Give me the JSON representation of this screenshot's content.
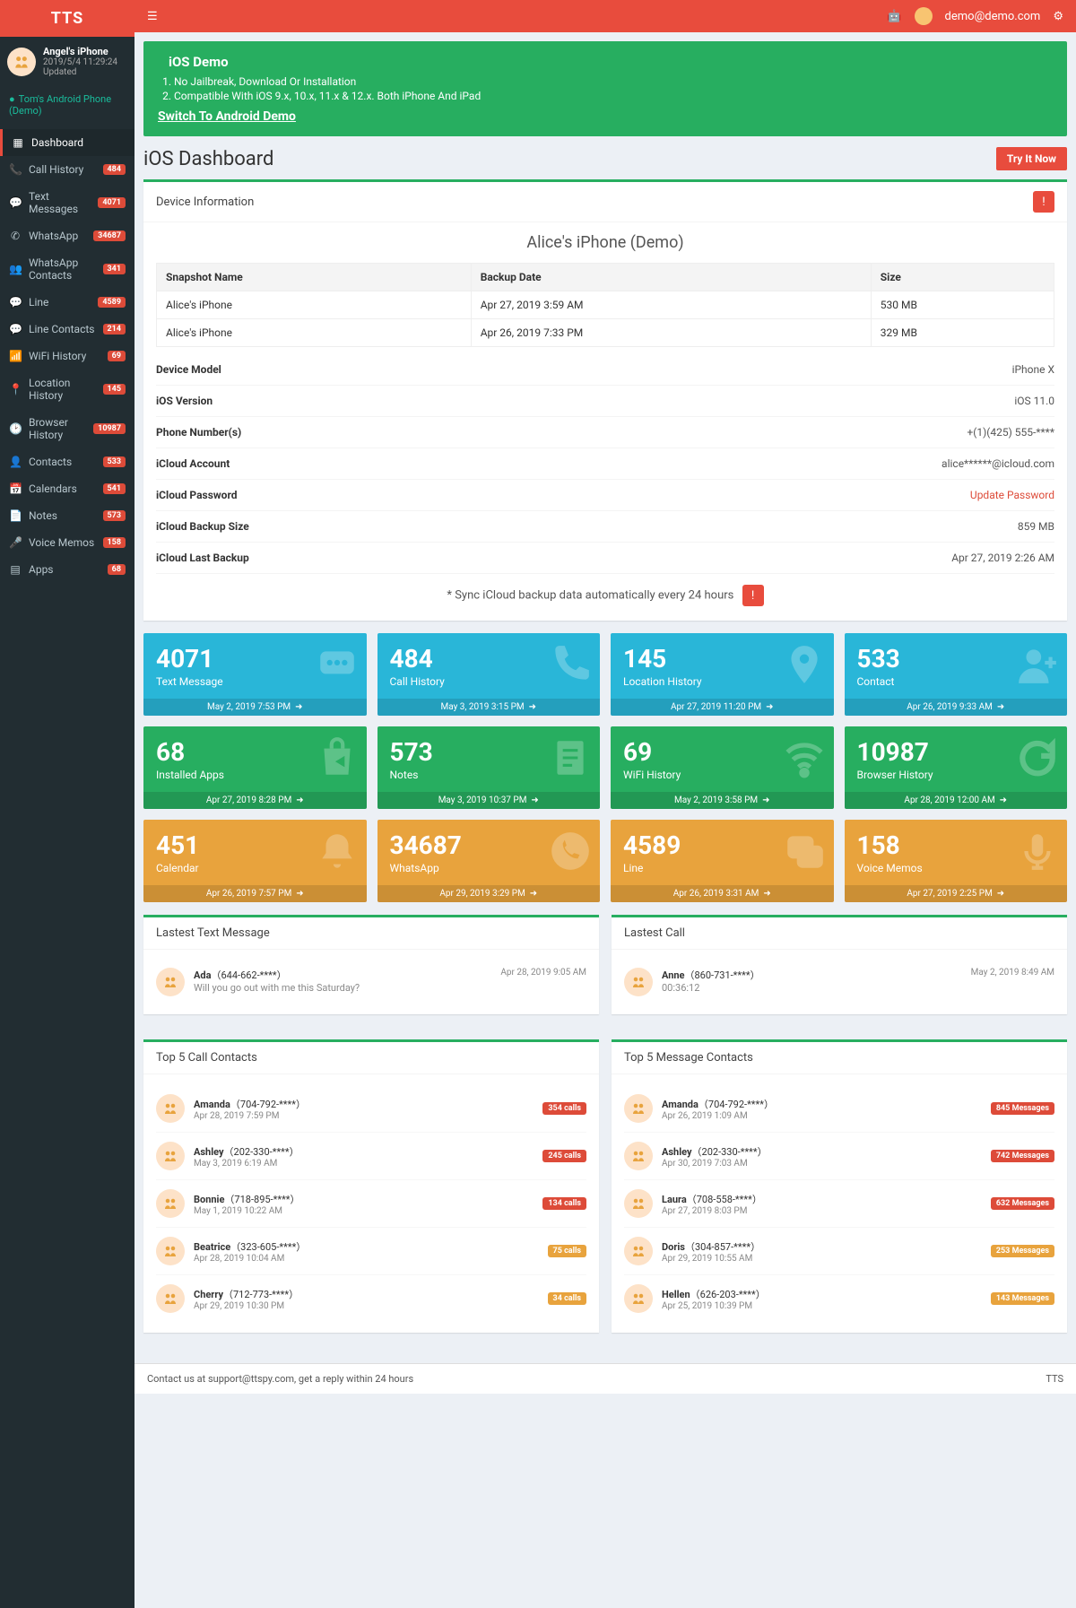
{
  "brand": "TTS",
  "header": {
    "email": "demo@demo.com"
  },
  "device": {
    "name": "Angel's iPhone",
    "updated": "2019/5/4 11:29:24 Updated"
  },
  "demoDevice": "Tom's Android Phone (Demo)",
  "nav": [
    {
      "icon": "grid",
      "label": "Dashboard",
      "active": true
    },
    {
      "icon": "phone",
      "label": "Call History",
      "badge": "484"
    },
    {
      "icon": "chat",
      "label": "Text Messages",
      "badge": "4071"
    },
    {
      "icon": "whatsapp",
      "label": "WhatsApp",
      "badge": "34687"
    },
    {
      "icon": "contacts",
      "label": "WhatsApp Contacts",
      "badge": "341"
    },
    {
      "icon": "line",
      "label": "Line",
      "badge": "4589"
    },
    {
      "icon": "line",
      "label": "Line Contacts",
      "badge": "214"
    },
    {
      "icon": "wifi",
      "label": "WiFi History",
      "badge": "69"
    },
    {
      "icon": "pin",
      "label": "Location History",
      "badge": "145"
    },
    {
      "icon": "clock",
      "label": "Browser History",
      "badge": "10987"
    },
    {
      "icon": "user",
      "label": "Contacts",
      "badge": "533"
    },
    {
      "icon": "calendar",
      "label": "Calendars",
      "badge": "541"
    },
    {
      "icon": "note",
      "label": "Notes",
      "badge": "573"
    },
    {
      "icon": "mic",
      "label": "Voice Memos",
      "badge": "158"
    },
    {
      "icon": "apps",
      "label": "Apps",
      "badge": "68"
    }
  ],
  "banner": {
    "title": "iOS Demo",
    "lines": [
      "No Jailbreak, Download Or Installation",
      "Compatible With iOS 9.x, 10.x, 11.x & 12.x. Both iPhone And iPad"
    ],
    "link": "Switch To Android Demo"
  },
  "page": {
    "title": "iOS Dashboard",
    "try": "Try It Now"
  },
  "devinfo": {
    "panelTitle": "Device Information",
    "deviceTitle": "Alice's iPhone (Demo)",
    "cols": [
      "Snapshot Name",
      "Backup Date",
      "Size"
    ],
    "snaps": [
      {
        "name": "Alice's iPhone",
        "date": "Apr 27, 2019 3:59 AM",
        "size": "530 MB"
      },
      {
        "name": "Alice's iPhone",
        "date": "Apr 26, 2019 7:33 PM",
        "size": "329 MB"
      }
    ],
    "rows": [
      {
        "k": "Device Model",
        "v": "iPhone X"
      },
      {
        "k": "iOS Version",
        "v": "iOS 11.0"
      },
      {
        "k": "Phone Number(s)",
        "v": "+(1)(425) 555-****"
      },
      {
        "k": "iCloud Account",
        "v": "alice******@icloud.com"
      },
      {
        "k": "iCloud Password",
        "v": "Update Password",
        "link": true
      },
      {
        "k": "iCloud Backup Size",
        "v": "859 MB"
      },
      {
        "k": "iCloud Last Backup",
        "v": "Apr 27, 2019 2:26 AM"
      }
    ],
    "sync": "* Sync iCloud backup data automatically every 24 hours"
  },
  "stats": [
    {
      "color": "blue",
      "num": "4071",
      "label": "Text Message",
      "ts": "May 2, 2019 7:53 PM",
      "icon": "chat"
    },
    {
      "color": "blue",
      "num": "484",
      "label": "Call History",
      "ts": "May 3, 2019 3:15 PM",
      "icon": "phone"
    },
    {
      "color": "blue",
      "num": "145",
      "label": "Location History",
      "ts": "Apr 27, 2019 11:20 PM",
      "icon": "pin"
    },
    {
      "color": "blue",
      "num": "533",
      "label": "Contact",
      "ts": "Apr 26, 2019 9:33 AM",
      "icon": "user"
    },
    {
      "color": "green",
      "num": "68",
      "label": "Installed Apps",
      "ts": "Apr 27, 2019 8:28 PM",
      "icon": "bag"
    },
    {
      "color": "green",
      "num": "573",
      "label": "Notes",
      "ts": "May 3, 2019 10:37 PM",
      "icon": "note"
    },
    {
      "color": "green",
      "num": "69",
      "label": "WiFi History",
      "ts": "May 2, 2019 3:58 PM",
      "icon": "wifi"
    },
    {
      "color": "green",
      "num": "10987",
      "label": "Browser History",
      "ts": "Apr 28, 2019 12:00 AM",
      "icon": "refresh"
    },
    {
      "color": "orange",
      "num": "451",
      "label": "Calendar",
      "ts": "Apr 26, 2019 7:57 PM",
      "icon": "bell"
    },
    {
      "color": "orange",
      "num": "34687",
      "label": "WhatsApp",
      "ts": "Apr 29, 2019 3:29 PM",
      "icon": "whatsapp"
    },
    {
      "color": "orange",
      "num": "4589",
      "label": "Line",
      "ts": "Apr 26, 2019 3:31 AM",
      "icon": "line"
    },
    {
      "color": "orange",
      "num": "158",
      "label": "Voice Memos",
      "ts": "Apr 27, 2019 2:25 PM",
      "icon": "mic"
    }
  ],
  "latestMsg": {
    "title": "Lastest Text Message",
    "name": "Ada",
    "phone": "（644-662-****）",
    "text": "Will you go out with me this Saturday?",
    "ts": "Apr 28, 2019 9:05 AM"
  },
  "latestCall": {
    "title": "Lastest Call",
    "name": "Anne",
    "phone": "（860-731-****）",
    "dur": "00:36:12",
    "ts": "May 2, 2019 8:49 AM"
  },
  "topCalls": {
    "title": "Top 5 Call Contacts",
    "unit": "calls",
    "items": [
      {
        "name": "Amanda",
        "phone": "（704-792-****）",
        "ts": "Apr 28, 2019 7:59 PM",
        "count": "354",
        "color": "red"
      },
      {
        "name": "Ashley",
        "phone": "（202-330-****）",
        "ts": "May 3, 2019 6:19 AM",
        "count": "245",
        "color": "red"
      },
      {
        "name": "Bonnie",
        "phone": "（718-895-****）",
        "ts": "May 1, 2019 10:22 AM",
        "count": "134",
        "color": "red"
      },
      {
        "name": "Beatrice",
        "phone": "（323-605-****）",
        "ts": "Apr 28, 2019 10:04 AM",
        "count": "75",
        "color": "orange"
      },
      {
        "name": "Cherry",
        "phone": "（712-773-****）",
        "ts": "Apr 29, 2019 10:30 PM",
        "count": "34",
        "color": "orange"
      }
    ]
  },
  "topMsgs": {
    "title": "Top 5 Message Contacts",
    "unit": "Messages",
    "items": [
      {
        "name": "Amanda",
        "phone": "（704-792-****）",
        "ts": "Apr 26, 2019 1:09 AM",
        "count": "845",
        "color": "red"
      },
      {
        "name": "Ashley",
        "phone": "（202-330-****）",
        "ts": "Apr 30, 2019 7:03 AM",
        "count": "742",
        "color": "red"
      },
      {
        "name": "Laura",
        "phone": "（708-558-****）",
        "ts": "Apr 27, 2019 8:03 PM",
        "count": "632",
        "color": "red"
      },
      {
        "name": "Doris",
        "phone": "（304-857-****）",
        "ts": "Apr 29, 2019 10:55 AM",
        "count": "253",
        "color": "orange"
      },
      {
        "name": "Hellen",
        "phone": "（626-203-****）",
        "ts": "Apr 25, 2019 10:39 PM",
        "count": "143",
        "color": "orange"
      }
    ]
  },
  "footer": {
    "left": "Contact us at support@ttspy.com, get a reply within 24 hours",
    "right": "TTS"
  }
}
